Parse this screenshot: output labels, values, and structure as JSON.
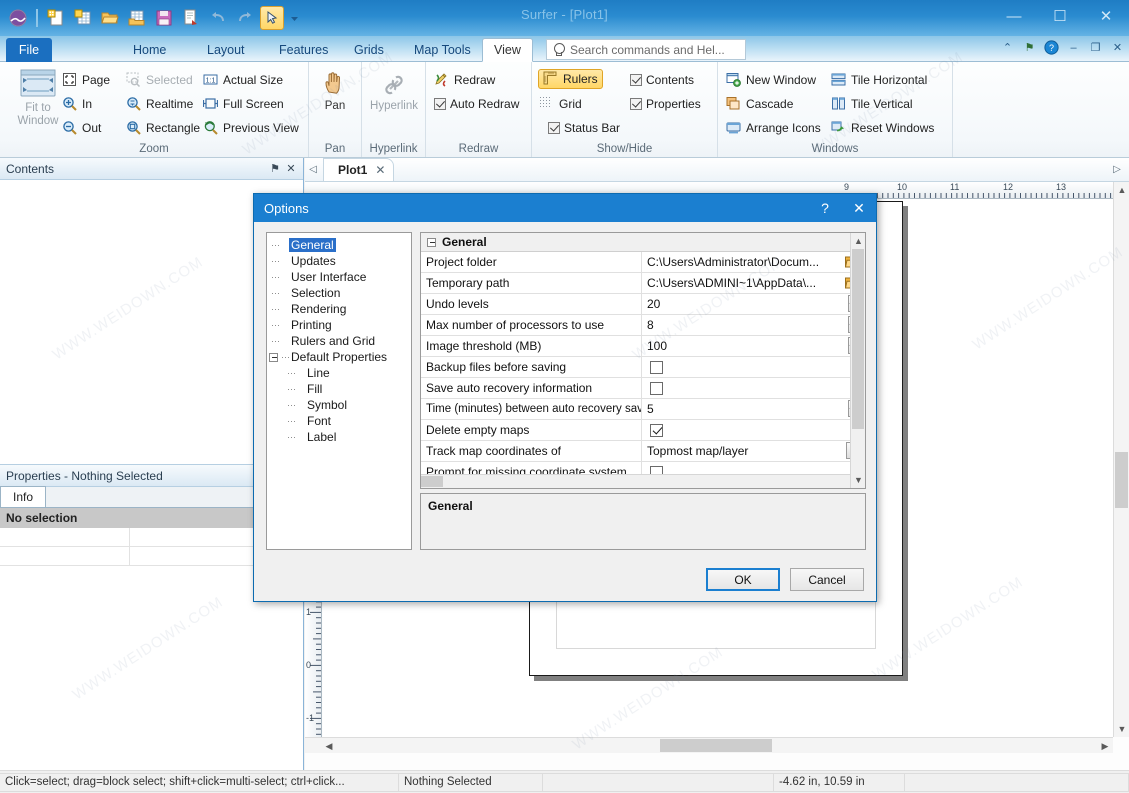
{
  "window": {
    "title": "Surfer - [Plot1]",
    "minimize": "—",
    "maximize": "☐",
    "close": "✕"
  },
  "quick_access": [
    {
      "name": "surfer-logo-icon",
      "label": "Surfer"
    },
    {
      "name": "new-plot-icon",
      "label": "New Plot"
    },
    {
      "name": "new-worksheet-icon",
      "label": "New Worksheet"
    },
    {
      "name": "open-icon",
      "label": "Open"
    },
    {
      "name": "open-worksheet-icon",
      "label": "Open Worksheet"
    },
    {
      "name": "save-icon",
      "label": "Save"
    },
    {
      "name": "export-icon",
      "label": "Export"
    },
    {
      "name": "undo-icon",
      "label": "Undo"
    },
    {
      "name": "redo-icon",
      "label": "Redo"
    },
    {
      "name": "select-tool-icon",
      "label": "Select"
    },
    {
      "name": "qat-dropdown-icon",
      "label": "Customize Quick Access Toolbar"
    }
  ],
  "tabs": [
    {
      "label": "File",
      "id": "file"
    },
    {
      "label": "Home",
      "id": "home"
    },
    {
      "label": "Layout",
      "id": "layout"
    },
    {
      "label": "Features",
      "id": "features"
    },
    {
      "label": "Grids",
      "id": "grids"
    },
    {
      "label": "Map Tools",
      "id": "map-tools"
    },
    {
      "label": "View",
      "id": "view",
      "active": true
    }
  ],
  "search": {
    "placeholder": "Search commands and Hel..."
  },
  "titlebar_right_icons": [
    {
      "name": "ribbon-collapse-icon",
      "glyph": "⌃"
    },
    {
      "name": "flag-icon",
      "glyph": "⚑"
    },
    {
      "name": "help-icon",
      "glyph": "?"
    },
    {
      "name": "mdi-minimize-icon",
      "glyph": "–"
    },
    {
      "name": "mdi-restore-icon",
      "glyph": "❐"
    },
    {
      "name": "mdi-close-icon",
      "glyph": "✕"
    }
  ],
  "ribbon": {
    "groups": [
      {
        "id": "zoom",
        "label": "Zoom",
        "big_button": {
          "label_line1": "Fit to",
          "label_line2": "Window",
          "enabled": false
        },
        "items": [
          {
            "label": "Page",
            "icon": "zoom-page-icon",
            "type": "button",
            "disabled": false
          },
          {
            "label": "Selected",
            "icon": "zoom-selected-icon",
            "type": "button",
            "disabled": true
          },
          {
            "label": "Actual Size",
            "icon": "actual-size-icon",
            "type": "button",
            "disabled": false
          },
          {
            "label": "In",
            "icon": "zoom-in-icon",
            "type": "button",
            "disabled": false
          },
          {
            "label": "Realtime",
            "icon": "zoom-realtime-icon",
            "type": "button",
            "disabled": false
          },
          {
            "label": "Full Screen",
            "icon": "full-screen-icon",
            "type": "button",
            "disabled": false
          },
          {
            "label": "Out",
            "icon": "zoom-out-icon",
            "type": "button",
            "disabled": false
          },
          {
            "label": "Rectangle",
            "icon": "zoom-rectangle-icon",
            "type": "button",
            "disabled": false
          },
          {
            "label": "Previous View",
            "icon": "previous-view-icon",
            "type": "button",
            "disabled": false
          }
        ]
      },
      {
        "id": "pan",
        "label": "Pan",
        "big_button": {
          "label_line1": "Pan",
          "label_line2": "",
          "enabled": true
        }
      },
      {
        "id": "hyperlink",
        "label": "Hyperlink",
        "big_button": {
          "label_line1": "Hyperlink",
          "label_line2": "",
          "enabled": false
        }
      },
      {
        "id": "redraw",
        "label": "Redraw",
        "items": [
          {
            "label": "Redraw",
            "icon": "redraw-icon",
            "type": "button",
            "checked": false
          },
          {
            "label": "Auto Redraw",
            "icon": "checkbox",
            "type": "checkbox",
            "checked": true
          }
        ]
      },
      {
        "id": "show-hide",
        "label": "Show/Hide",
        "items": [
          {
            "label": "Rulers",
            "icon": "rulers-icon",
            "type": "toggle",
            "checked": true
          },
          {
            "label": "Contents",
            "icon": "checkbox",
            "type": "checkbox",
            "checked": true
          },
          {
            "label": "Grid",
            "icon": "grid-icon",
            "type": "toggle",
            "checked": false
          },
          {
            "label": "Properties",
            "icon": "checkbox",
            "type": "checkbox",
            "checked": true
          },
          {
            "label": "Status Bar",
            "icon": "checkbox",
            "type": "checkbox",
            "checked": true
          }
        ]
      },
      {
        "id": "windows",
        "label": "Windows",
        "items": [
          {
            "label": "New Window",
            "icon": "new-window-icon",
            "type": "button"
          },
          {
            "label": "Tile Horizontal",
            "icon": "tile-horizontal-icon",
            "type": "button"
          },
          {
            "label": "Cascade",
            "icon": "cascade-icon",
            "type": "button"
          },
          {
            "label": "Tile Vertical",
            "icon": "tile-vertical-icon",
            "type": "button"
          },
          {
            "label": "Arrange Icons",
            "icon": "arrange-icons-icon",
            "type": "button"
          },
          {
            "label": "Reset Windows",
            "icon": "reset-windows-icon",
            "type": "button"
          }
        ]
      }
    ]
  },
  "contents_panel": {
    "title": "Contents",
    "pin_glyph": "⚑",
    "close_glyph": "✕"
  },
  "properties_panel": {
    "title": "Properties - Nothing Selected",
    "tab_label": "Info",
    "no_selection": "No selection"
  },
  "document": {
    "tab_label": "Plot1",
    "tab_close": "✕",
    "nav_left": "◁",
    "nav_right": "▷",
    "h_ruler_ticks": [
      "9",
      "10",
      "11",
      "12",
      "13"
    ],
    "v_ruler_ticks": [
      "1",
      "0",
      "-1"
    ]
  },
  "statusbar": {
    "hint": "Click=select; drag=block select; shift+click=multi-select; ctrl+click...",
    "selection": "Nothing Selected",
    "blank1": "",
    "coordinates": "-4.62 in, 10.59 in",
    "blank2": ""
  },
  "dialog": {
    "title": "Options",
    "help_glyph": "?",
    "close_glyph": "✕",
    "tree": [
      {
        "label": "General",
        "selected": true,
        "child": false
      },
      {
        "label": "Updates",
        "selected": false,
        "child": false
      },
      {
        "label": "User Interface",
        "selected": false,
        "child": false
      },
      {
        "label": "Selection",
        "selected": false,
        "child": false
      },
      {
        "label": "Rendering",
        "selected": false,
        "child": false
      },
      {
        "label": "Printing",
        "selected": false,
        "child": false
      },
      {
        "label": "Rulers and Grid",
        "selected": false,
        "child": false
      },
      {
        "label": "Default Properties",
        "selected": false,
        "child": false,
        "expander": true
      },
      {
        "label": "Line",
        "selected": false,
        "child": true
      },
      {
        "label": "Fill",
        "selected": false,
        "child": true
      },
      {
        "label": "Symbol",
        "selected": false,
        "child": true
      },
      {
        "label": "Font",
        "selected": false,
        "child": true
      },
      {
        "label": "Label",
        "selected": false,
        "child": true
      }
    ],
    "grid_header": "General",
    "rows": [
      {
        "label": "Project folder",
        "value": "C:\\Users\\Administrator\\Docum...",
        "control": "folder"
      },
      {
        "label": "Temporary path",
        "value": "C:\\Users\\ADMINI~1\\AppData\\...",
        "control": "folder"
      },
      {
        "label": "Undo levels",
        "value": "20",
        "control": "spin"
      },
      {
        "label": "Max number of processors to use",
        "value": "8",
        "control": "spin"
      },
      {
        "label": "Image threshold (MB)",
        "value": "100",
        "control": "spin"
      },
      {
        "label": "Backup files before saving",
        "value": "",
        "control": "checkbox",
        "checked": false
      },
      {
        "label": "Save auto recovery information",
        "value": "",
        "control": "checkbox",
        "checked": false
      },
      {
        "label": "Time (minutes) between auto recovery saves",
        "value": "5",
        "control": "spin"
      },
      {
        "label": "Delete empty maps",
        "value": "",
        "control": "checkbox",
        "checked": true
      },
      {
        "label": "Track map coordinates of",
        "value": "Topmost map/layer",
        "control": "combo"
      },
      {
        "label": "Prompt for missing coordinate system",
        "value": "",
        "control": "checkbox",
        "checked": false
      }
    ],
    "description": "General",
    "ok_label": "OK",
    "cancel_label": "Cancel"
  },
  "colors": {
    "titlebar_blue": "#2a8bd0",
    "dialog_title_blue": "#1b7fd0",
    "tab_selection_blue": "#2a6fc9",
    "highlight_yellow": "#ffd766",
    "accent_border": "#0d6bb0"
  },
  "watermark": {
    "text": "WWW.WEIDOWN.COM"
  }
}
